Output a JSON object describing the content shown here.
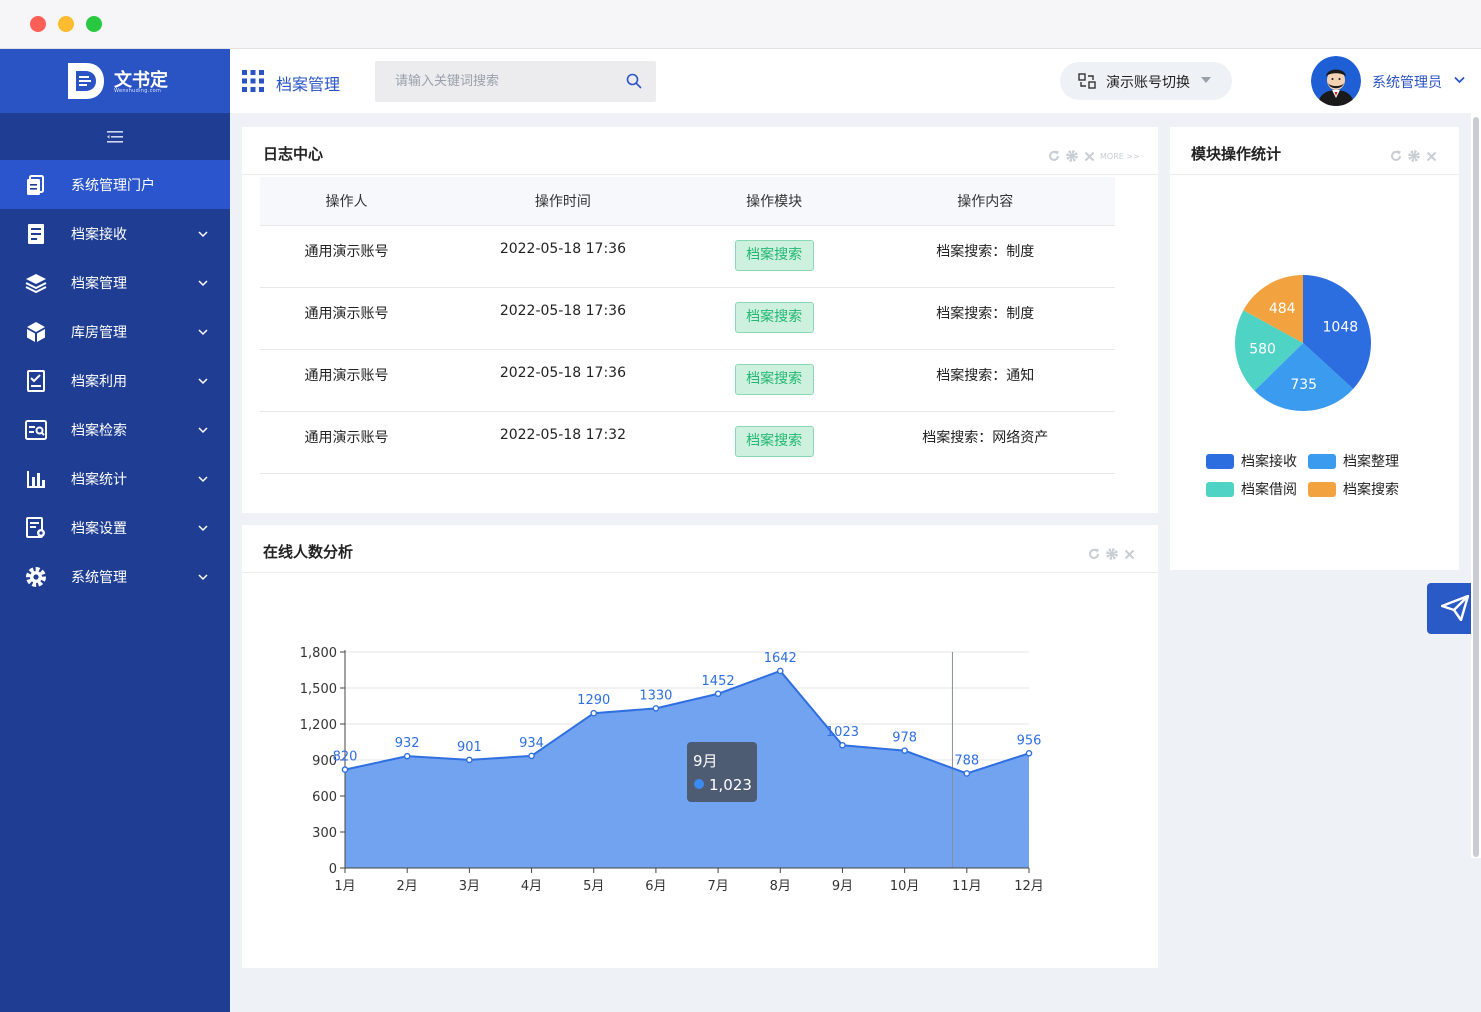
{
  "app": {
    "brand_name": "文书定",
    "brand_sub": "Wenshuding.com"
  },
  "sidebar": {
    "items": [
      {
        "label": "系统管理门户",
        "icon": "document-copy-icon",
        "active": true
      },
      {
        "label": "档案接收",
        "icon": "receive-list-icon"
      },
      {
        "label": "档案管理",
        "icon": "layers-icon"
      },
      {
        "label": "库房管理",
        "icon": "cube-icon"
      },
      {
        "label": "档案利用",
        "icon": "checklist-icon"
      },
      {
        "label": "档案检索",
        "icon": "search-doc-icon"
      },
      {
        "label": "档案统计",
        "icon": "bar-chart-icon"
      },
      {
        "label": "档案设置",
        "icon": "settings-doc-icon"
      },
      {
        "label": "系统管理",
        "icon": "gear-icon"
      }
    ]
  },
  "header": {
    "title": "档案管理",
    "search_placeholder": "请输入关键词搜索",
    "account_switch": "演示账号切换",
    "user_name": "系统管理员"
  },
  "log_panel": {
    "title": "日志中心",
    "more": "MORE >>",
    "columns": [
      "操作人",
      "操作时间",
      "操作模块",
      "操作内容"
    ],
    "rows": [
      {
        "user": "通用演示账号",
        "time": "2022-05-18 17:36",
        "module": "档案搜索",
        "content": "档案搜索：制度"
      },
      {
        "user": "通用演示账号",
        "time": "2022-05-18 17:36",
        "module": "档案搜索",
        "content": "档案搜索：制度"
      },
      {
        "user": "通用演示账号",
        "time": "2022-05-18 17:36",
        "module": "档案搜索",
        "content": "档案搜索：通知"
      },
      {
        "user": "通用演示账号",
        "time": "2022-05-18 17:32",
        "module": "档案搜索",
        "content": "档案搜索：网络资产"
      }
    ]
  },
  "online_panel": {
    "title": "在线人数分析"
  },
  "module_panel": {
    "title": "模块操作统计"
  },
  "colors": {
    "accent": "#2a53c4",
    "sidebar": "#1f3e93",
    "area": "#6a9ef0",
    "line": "#2f6fe0"
  },
  "chart_data": [
    {
      "type": "area",
      "categories": [
        "1月",
        "2月",
        "3月",
        "4月",
        "5月",
        "6月",
        "7月",
        "8月",
        "9月",
        "10月",
        "11月",
        "12月"
      ],
      "values": [
        820,
        932,
        901,
        934,
        1290,
        1330,
        1452,
        1642,
        1023,
        978,
        788,
        956
      ],
      "yticks": [
        "0",
        "300",
        "600",
        "900",
        "1,200",
        "1,500",
        "1,800"
      ],
      "ylim": [
        0,
        1800
      ],
      "tooltip": {
        "label": "9月",
        "value": "1,023",
        "category_index": 8
      },
      "grid": true
    },
    {
      "type": "pie",
      "slices": [
        {
          "name": "档案接收",
          "value": 1048,
          "color": "#2c6de0"
        },
        {
          "name": "档案整理",
          "value": 735,
          "color": "#3a9bef"
        },
        {
          "name": "档案借阅",
          "value": 580,
          "color": "#4ed3c4"
        },
        {
          "name": "档案搜索",
          "value": 484,
          "color": "#f2a23f"
        }
      ],
      "legend": "bottom"
    }
  ]
}
